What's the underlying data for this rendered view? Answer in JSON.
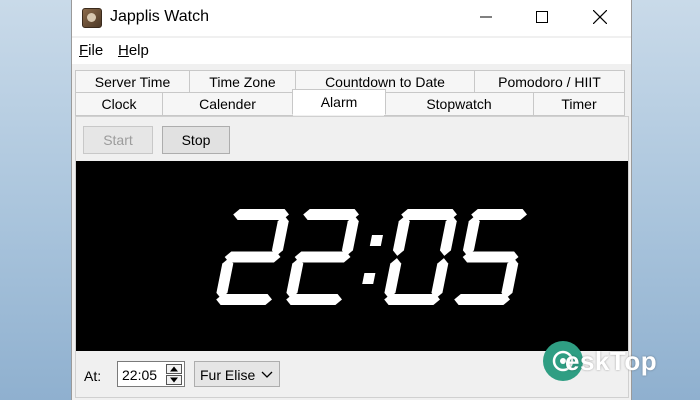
{
  "window": {
    "title": "Japplis Watch"
  },
  "menu": {
    "file": "File",
    "help": "Help"
  },
  "tabs": {
    "row1": [
      "Server Time",
      "Time Zone",
      "Countdown to Date",
      "Pomodoro / HIIT"
    ],
    "row2": [
      "Clock",
      "Calender",
      "Alarm",
      "Stopwatch",
      "Timer"
    ],
    "selected": "Alarm"
  },
  "controls": {
    "start_label": "Start",
    "stop_label": "Stop"
  },
  "display": {
    "time": "22:05"
  },
  "alarm": {
    "at_label": "At:",
    "time_value": "22:05",
    "sound_value": "Fur Elise"
  },
  "watermark": {
    "text": "eskTop"
  },
  "colors": {
    "display_bg": "#000000",
    "digit": "#ffffff",
    "watermark": "#2f9e83"
  }
}
